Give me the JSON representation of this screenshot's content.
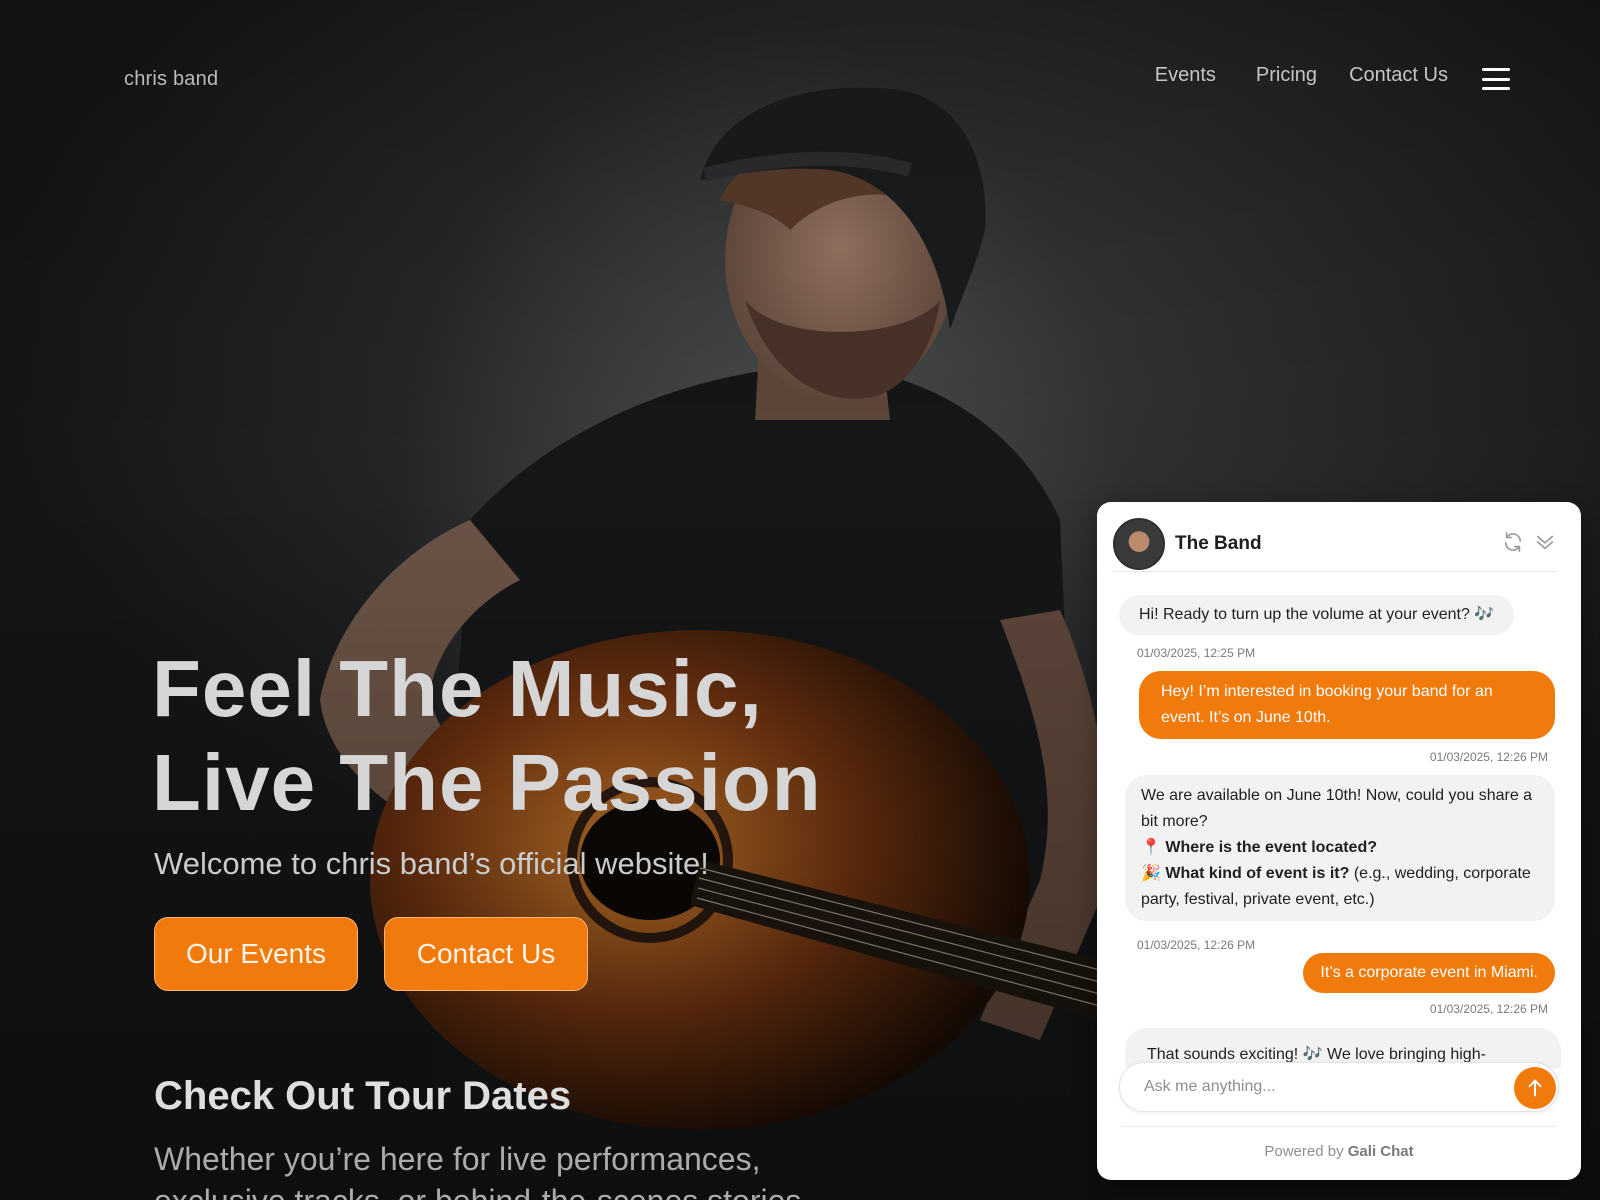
{
  "nav": {
    "logo": "chris band",
    "links": [
      "Events",
      "Pricing",
      "Contact Us"
    ]
  },
  "hero": {
    "headline_line1": "Feel The Music,",
    "headline_line2": "Live The Passion",
    "subtitle": "Welcome to chris band’s official website!",
    "buttons": [
      "Our Events",
      "Contact Us"
    ]
  },
  "tour": {
    "title": "Check Out Tour Dates",
    "text": "Whether you’re here for live performances, exclusive tracks, or behind-the-scenes stories"
  },
  "chat": {
    "title": "The Band",
    "messages": [
      {
        "role": "bot",
        "text": "Hi! Ready to turn up the volume at your event? 🎶",
        "time": "01/03/2025, 12:25 PM"
      },
      {
        "role": "user",
        "text": "Hey! I’m interested in booking your band for an event. It’s on June 10th.",
        "time": "01/03/2025, 12:26 PM"
      },
      {
        "role": "bot",
        "intro": "We are available on June 10th! Now, could you share a bit more?",
        "q1_icon": "📍",
        "q1": "Where is the event located?",
        "q2_icon": "🎉",
        "q2": "What kind of event is it?",
        "q2_tail": " (e.g., wedding, corporate party, festival, private event, etc.)",
        "time": "01/03/2025, 12:26 PM"
      },
      {
        "role": "user",
        "text": "It’s a corporate event in Miami.",
        "time": "01/03/2025, 12:26 PM"
      },
      {
        "role": "bot",
        "text": "That sounds exciting! 🎶 We love bringing high-"
      }
    ],
    "input_placeholder": "Ask me anything...",
    "powered_prefix": "Powered by",
    "powered_brand": "Gali Chat"
  },
  "colors": {
    "accent": "#f07a0c",
    "bot_bubble": "#f2f2f2"
  }
}
